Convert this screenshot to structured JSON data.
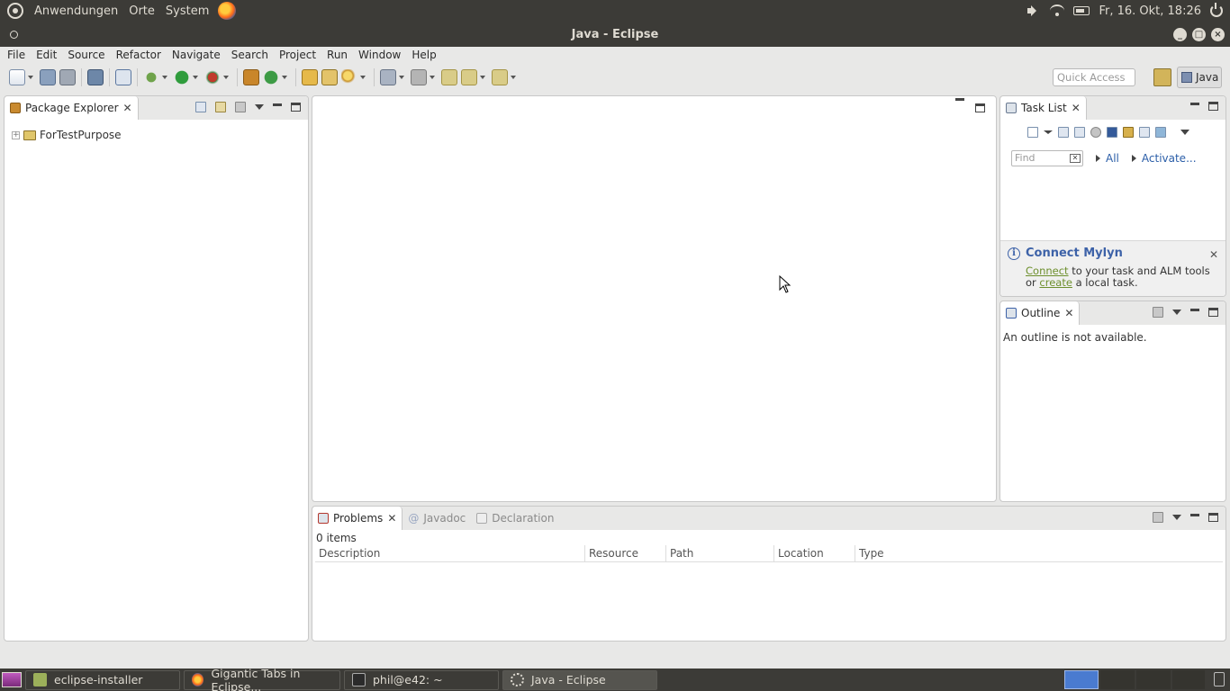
{
  "system_panel": {
    "menus": [
      "Anwendungen",
      "Orte",
      "System"
    ],
    "clock": "Fr, 16. Okt, 18:26",
    "icons": [
      "ubuntu-icon",
      "firefox-icon",
      "volume-icon",
      "wifi-icon",
      "battery-icon",
      "power-icon"
    ]
  },
  "window": {
    "title": "Java - Eclipse"
  },
  "menubar": {
    "items": [
      "File",
      "Edit",
      "Source",
      "Refactor",
      "Navigate",
      "Search",
      "Project",
      "Run",
      "Window",
      "Help"
    ]
  },
  "toolbar": {
    "quick_access_placeholder": "Quick Access",
    "perspective_label": "Java"
  },
  "package_explorer": {
    "tab_label": "Package Explorer",
    "tree": [
      {
        "label": "ForTestPurpose",
        "expanded": false
      }
    ]
  },
  "task_list": {
    "tab_label": "Task List",
    "find_placeholder": "Find",
    "all_label": "All",
    "activate_label": "Activate..."
  },
  "mylyn": {
    "title": "Connect Mylyn",
    "connect_link": "Connect",
    "text_after_connect": " to your task and ALM tools or ",
    "create_link": "create",
    "text_after_create": " a local task."
  },
  "outline": {
    "tab_label": "Outline",
    "message": "An outline is not available."
  },
  "bottom_views": {
    "tabs": [
      {
        "label": "Problems",
        "active": true
      },
      {
        "label": "Javadoc",
        "active": false
      },
      {
        "label": "Declaration",
        "active": false
      }
    ],
    "status": "0 items",
    "columns": [
      "Description",
      "Resource",
      "Path",
      "Location",
      "Type"
    ]
  },
  "taskbar": {
    "tasks": [
      {
        "label": "eclipse-installer",
        "active": false
      },
      {
        "label": "Gigantic Tabs in Eclipse...",
        "active": false
      },
      {
        "label": "phil@e42: ~",
        "active": false
      },
      {
        "label": "Java - Eclipse",
        "active": true
      }
    ]
  }
}
